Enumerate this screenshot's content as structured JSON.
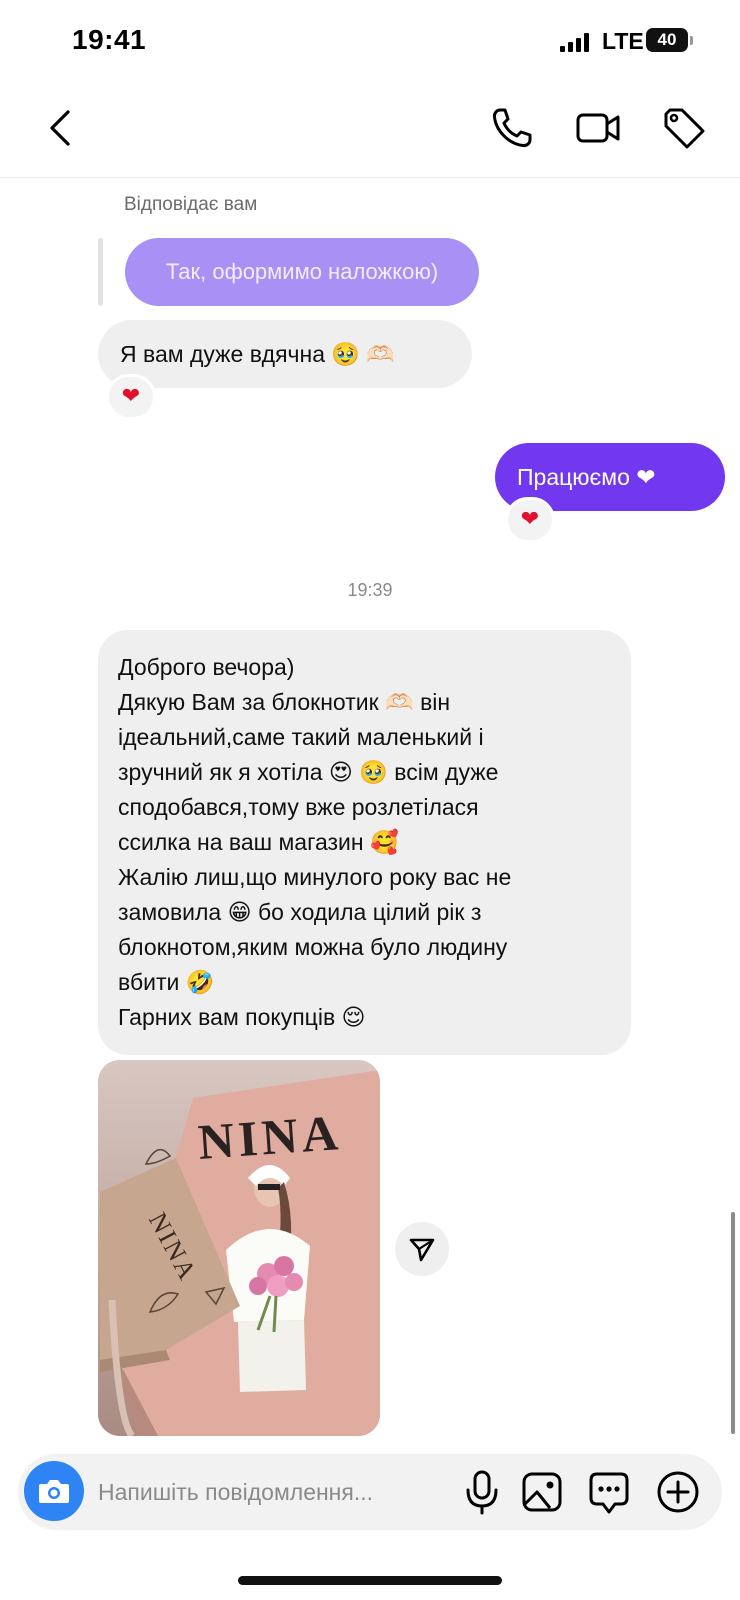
{
  "status_bar": {
    "time": "19:41",
    "network": "LTE",
    "battery": "40"
  },
  "nav": {
    "icons": [
      "chevron-left-icon",
      "phone-icon",
      "video-camera-icon",
      "tag-icon"
    ]
  },
  "thread": {
    "reply_label": "Відповідає вам",
    "replied_message": "Так, оформимо наложкою)",
    "incoming_thanks": "Я вам дуже вдячна 🥹 🫶🏻",
    "incoming_thanks_reaction": "❤",
    "outgoing_message": "Працюємо ❤",
    "outgoing_reaction": "❤",
    "timestamp": "19:39",
    "long_message_lines": [
      "Доброго вечора)",
      "Дякую Вам за блокнотик 🫶🏻 він",
      "ідеальний,саме такий маленький і",
      "зручний як я хотіла 😍 🥹 всім дуже",
      "сподобався,тому вже розлетілася",
      "ссилка на ваш магазин 🥰",
      "Жалію лиш,що минулого року вас не",
      "замовила 😁 бо ходила цілий рік з",
      "блокнотом,яким можна було людину",
      "вбити 🤣",
      "Гарних вам покупців 😌"
    ],
    "photo": {
      "notebook_title": "NINA",
      "card_title": "NINA"
    }
  },
  "composer": {
    "placeholder": "Напишіть повідомлення...",
    "icons": [
      "camera-icon",
      "microphone-icon",
      "gallery-icon",
      "sticker-icon",
      "plus-icon"
    ],
    "camera_color": "#2e83f5"
  },
  "colors": {
    "outgoing_bubble": "#7138f0",
    "reply_bubble": "#a990f5",
    "incoming_bubble": "#efefef"
  }
}
